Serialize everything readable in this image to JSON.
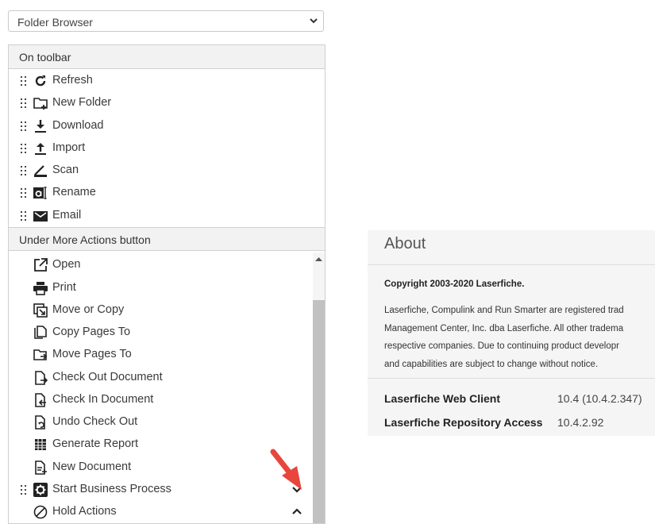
{
  "dropdown": {
    "selected": "Folder Browser"
  },
  "toolbar_section": {
    "title": "On toolbar",
    "items": [
      {
        "label": "Refresh",
        "icon": "refresh-icon"
      },
      {
        "label": "New Folder",
        "icon": "new-folder-icon"
      },
      {
        "label": "Download",
        "icon": "download-icon"
      },
      {
        "label": "Import",
        "icon": "import-icon"
      },
      {
        "label": "Scan",
        "icon": "scan-icon"
      },
      {
        "label": "Rename",
        "icon": "rename-icon"
      },
      {
        "label": "Email",
        "icon": "email-icon"
      }
    ]
  },
  "more_section": {
    "title": "Under More Actions button",
    "items": [
      {
        "label": "Open",
        "icon": "open-external-icon"
      },
      {
        "label": "Print",
        "icon": "print-icon"
      },
      {
        "label": "Move or Copy",
        "icon": "move-copy-icon"
      },
      {
        "label": "Copy Pages To",
        "icon": "copy-pages-icon"
      },
      {
        "label": "Move Pages To",
        "icon": "move-pages-icon"
      },
      {
        "label": "Check Out Document",
        "icon": "check-out-icon"
      },
      {
        "label": "Check In Document",
        "icon": "check-in-icon"
      },
      {
        "label": "Undo Check Out",
        "icon": "undo-check-out-icon"
      },
      {
        "label": "Generate Report",
        "icon": "report-icon"
      },
      {
        "label": "New Document",
        "icon": "new-document-icon"
      },
      {
        "label": "Start Business Process",
        "icon": "business-process-icon"
      },
      {
        "label": "Hold Actions",
        "icon": "hold-icon"
      }
    ]
  },
  "about": {
    "title": "About",
    "copyright": "Copyright 2003-2020 Laserfiche.",
    "paragraph_lines": [
      "Laserfiche, Compulink and Run Smarter are registered trad",
      "Management Center, Inc. dba Laserfiche. All other tradema",
      "respective companies. Due to continuing product developr",
      "and capabilities are subject to change without notice."
    ],
    "rows": [
      {
        "key": "Laserfiche Web Client",
        "value": "10.4 (10.4.2.347)"
      },
      {
        "key": "Laserfiche Repository Access",
        "value": "10.4.2.92"
      }
    ]
  },
  "colors": {
    "annotation_arrow": "#e8453c",
    "scrollbar_thumb": "#c1c1c1"
  }
}
